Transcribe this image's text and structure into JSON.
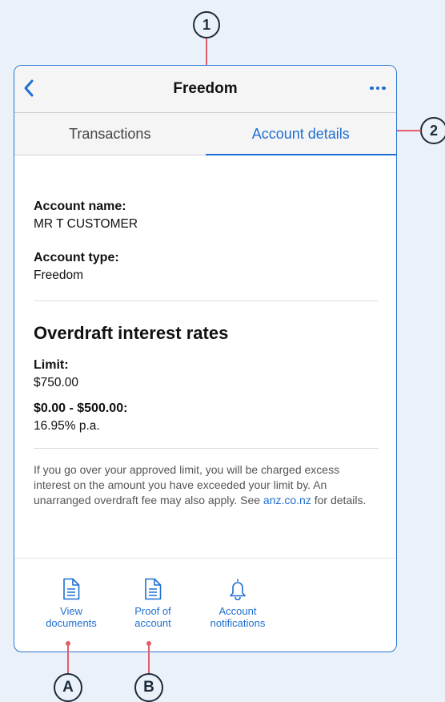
{
  "callouts": {
    "c1": "1",
    "c2": "2",
    "cA": "A",
    "cB": "B"
  },
  "header": {
    "title": "Freedom",
    "back_icon": "chevron-left-icon",
    "menu_icon": "more-horizontal-icon"
  },
  "tabs": [
    {
      "label": "Transactions",
      "active": false
    },
    {
      "label": "Account details",
      "active": true
    }
  ],
  "account": {
    "name_label": "Account name:",
    "name_value": "MR T CUSTOMER",
    "type_label": "Account type:",
    "type_value": "Freedom"
  },
  "overdraft": {
    "title": "Overdraft interest rates",
    "limit_label": "Limit:",
    "limit_value": "$750.00",
    "band_label": "$0.00 - $500.00:",
    "band_value": "16.95% p.a."
  },
  "disclaimer": {
    "text_before": "If you go over your approved limit, you will be charged excess interest on the amount you have exceeded your limit by. An unarranged overdraft fee may also apply. See ",
    "link": "anz.co.nz",
    "text_after": " for details."
  },
  "actions": [
    {
      "line1": "View",
      "line2": "documents",
      "icon": "document-icon"
    },
    {
      "line1": "Proof of",
      "line2": "account",
      "icon": "document-icon"
    },
    {
      "line1": "Account",
      "line2": "notifications",
      "icon": "bell-icon"
    }
  ],
  "colors": {
    "accent": "#1f6fd1",
    "callout_line": "#e35d6a",
    "background": "#eaf1f8"
  }
}
